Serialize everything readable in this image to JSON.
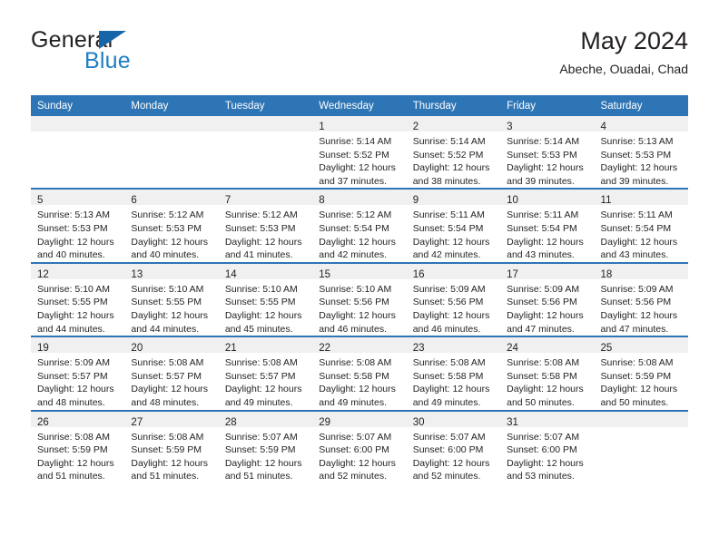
{
  "brand": {
    "name_top": "General",
    "name_bottom": "Blue",
    "triangle_color": "#1565a8",
    "blue_text_color": "#1f7ec4"
  },
  "header": {
    "title": "May 2024",
    "subtitle": "Abeche, Ouadai, Chad"
  },
  "theme": {
    "header_blue": "#2e75b6",
    "daynum_band": "#f0f0f0",
    "text": "#231f20"
  },
  "weekday_headers": [
    "Sunday",
    "Monday",
    "Tuesday",
    "Wednesday",
    "Thursday",
    "Friday",
    "Saturday"
  ],
  "weeks": [
    [
      {
        "day": "",
        "lines": []
      },
      {
        "day": "",
        "lines": []
      },
      {
        "day": "",
        "lines": []
      },
      {
        "day": "1",
        "lines": [
          "Sunrise: 5:14 AM",
          "Sunset: 5:52 PM",
          "Daylight: 12 hours",
          "and 37 minutes."
        ]
      },
      {
        "day": "2",
        "lines": [
          "Sunrise: 5:14 AM",
          "Sunset: 5:52 PM",
          "Daylight: 12 hours",
          "and 38 minutes."
        ]
      },
      {
        "day": "3",
        "lines": [
          "Sunrise: 5:14 AM",
          "Sunset: 5:53 PM",
          "Daylight: 12 hours",
          "and 39 minutes."
        ]
      },
      {
        "day": "4",
        "lines": [
          "Sunrise: 5:13 AM",
          "Sunset: 5:53 PM",
          "Daylight: 12 hours",
          "and 39 minutes."
        ]
      }
    ],
    [
      {
        "day": "5",
        "lines": [
          "Sunrise: 5:13 AM",
          "Sunset: 5:53 PM",
          "Daylight: 12 hours",
          "and 40 minutes."
        ]
      },
      {
        "day": "6",
        "lines": [
          "Sunrise: 5:12 AM",
          "Sunset: 5:53 PM",
          "Daylight: 12 hours",
          "and 40 minutes."
        ]
      },
      {
        "day": "7",
        "lines": [
          "Sunrise: 5:12 AM",
          "Sunset: 5:53 PM",
          "Daylight: 12 hours",
          "and 41 minutes."
        ]
      },
      {
        "day": "8",
        "lines": [
          "Sunrise: 5:12 AM",
          "Sunset: 5:54 PM",
          "Daylight: 12 hours",
          "and 42 minutes."
        ]
      },
      {
        "day": "9",
        "lines": [
          "Sunrise: 5:11 AM",
          "Sunset: 5:54 PM",
          "Daylight: 12 hours",
          "and 42 minutes."
        ]
      },
      {
        "day": "10",
        "lines": [
          "Sunrise: 5:11 AM",
          "Sunset: 5:54 PM",
          "Daylight: 12 hours",
          "and 43 minutes."
        ]
      },
      {
        "day": "11",
        "lines": [
          "Sunrise: 5:11 AM",
          "Sunset: 5:54 PM",
          "Daylight: 12 hours",
          "and 43 minutes."
        ]
      }
    ],
    [
      {
        "day": "12",
        "lines": [
          "Sunrise: 5:10 AM",
          "Sunset: 5:55 PM",
          "Daylight: 12 hours",
          "and 44 minutes."
        ]
      },
      {
        "day": "13",
        "lines": [
          "Sunrise: 5:10 AM",
          "Sunset: 5:55 PM",
          "Daylight: 12 hours",
          "and 44 minutes."
        ]
      },
      {
        "day": "14",
        "lines": [
          "Sunrise: 5:10 AM",
          "Sunset: 5:55 PM",
          "Daylight: 12 hours",
          "and 45 minutes."
        ]
      },
      {
        "day": "15",
        "lines": [
          "Sunrise: 5:10 AM",
          "Sunset: 5:56 PM",
          "Daylight: 12 hours",
          "and 46 minutes."
        ]
      },
      {
        "day": "16",
        "lines": [
          "Sunrise: 5:09 AM",
          "Sunset: 5:56 PM",
          "Daylight: 12 hours",
          "and 46 minutes."
        ]
      },
      {
        "day": "17",
        "lines": [
          "Sunrise: 5:09 AM",
          "Sunset: 5:56 PM",
          "Daylight: 12 hours",
          "and 47 minutes."
        ]
      },
      {
        "day": "18",
        "lines": [
          "Sunrise: 5:09 AM",
          "Sunset: 5:56 PM",
          "Daylight: 12 hours",
          "and 47 minutes."
        ]
      }
    ],
    [
      {
        "day": "19",
        "lines": [
          "Sunrise: 5:09 AM",
          "Sunset: 5:57 PM",
          "Daylight: 12 hours",
          "and 48 minutes."
        ]
      },
      {
        "day": "20",
        "lines": [
          "Sunrise: 5:08 AM",
          "Sunset: 5:57 PM",
          "Daylight: 12 hours",
          "and 48 minutes."
        ]
      },
      {
        "day": "21",
        "lines": [
          "Sunrise: 5:08 AM",
          "Sunset: 5:57 PM",
          "Daylight: 12 hours",
          "and 49 minutes."
        ]
      },
      {
        "day": "22",
        "lines": [
          "Sunrise: 5:08 AM",
          "Sunset: 5:58 PM",
          "Daylight: 12 hours",
          "and 49 minutes."
        ]
      },
      {
        "day": "23",
        "lines": [
          "Sunrise: 5:08 AM",
          "Sunset: 5:58 PM",
          "Daylight: 12 hours",
          "and 49 minutes."
        ]
      },
      {
        "day": "24",
        "lines": [
          "Sunrise: 5:08 AM",
          "Sunset: 5:58 PM",
          "Daylight: 12 hours",
          "and 50 minutes."
        ]
      },
      {
        "day": "25",
        "lines": [
          "Sunrise: 5:08 AM",
          "Sunset: 5:59 PM",
          "Daylight: 12 hours",
          "and 50 minutes."
        ]
      }
    ],
    [
      {
        "day": "26",
        "lines": [
          "Sunrise: 5:08 AM",
          "Sunset: 5:59 PM",
          "Daylight: 12 hours",
          "and 51 minutes."
        ]
      },
      {
        "day": "27",
        "lines": [
          "Sunrise: 5:08 AM",
          "Sunset: 5:59 PM",
          "Daylight: 12 hours",
          "and 51 minutes."
        ]
      },
      {
        "day": "28",
        "lines": [
          "Sunrise: 5:07 AM",
          "Sunset: 5:59 PM",
          "Daylight: 12 hours",
          "and 51 minutes."
        ]
      },
      {
        "day": "29",
        "lines": [
          "Sunrise: 5:07 AM",
          "Sunset: 6:00 PM",
          "Daylight: 12 hours",
          "and 52 minutes."
        ]
      },
      {
        "day": "30",
        "lines": [
          "Sunrise: 5:07 AM",
          "Sunset: 6:00 PM",
          "Daylight: 12 hours",
          "and 52 minutes."
        ]
      },
      {
        "day": "31",
        "lines": [
          "Sunrise: 5:07 AM",
          "Sunset: 6:00 PM",
          "Daylight: 12 hours",
          "and 53 minutes."
        ]
      },
      {
        "day": "",
        "lines": []
      }
    ]
  ]
}
